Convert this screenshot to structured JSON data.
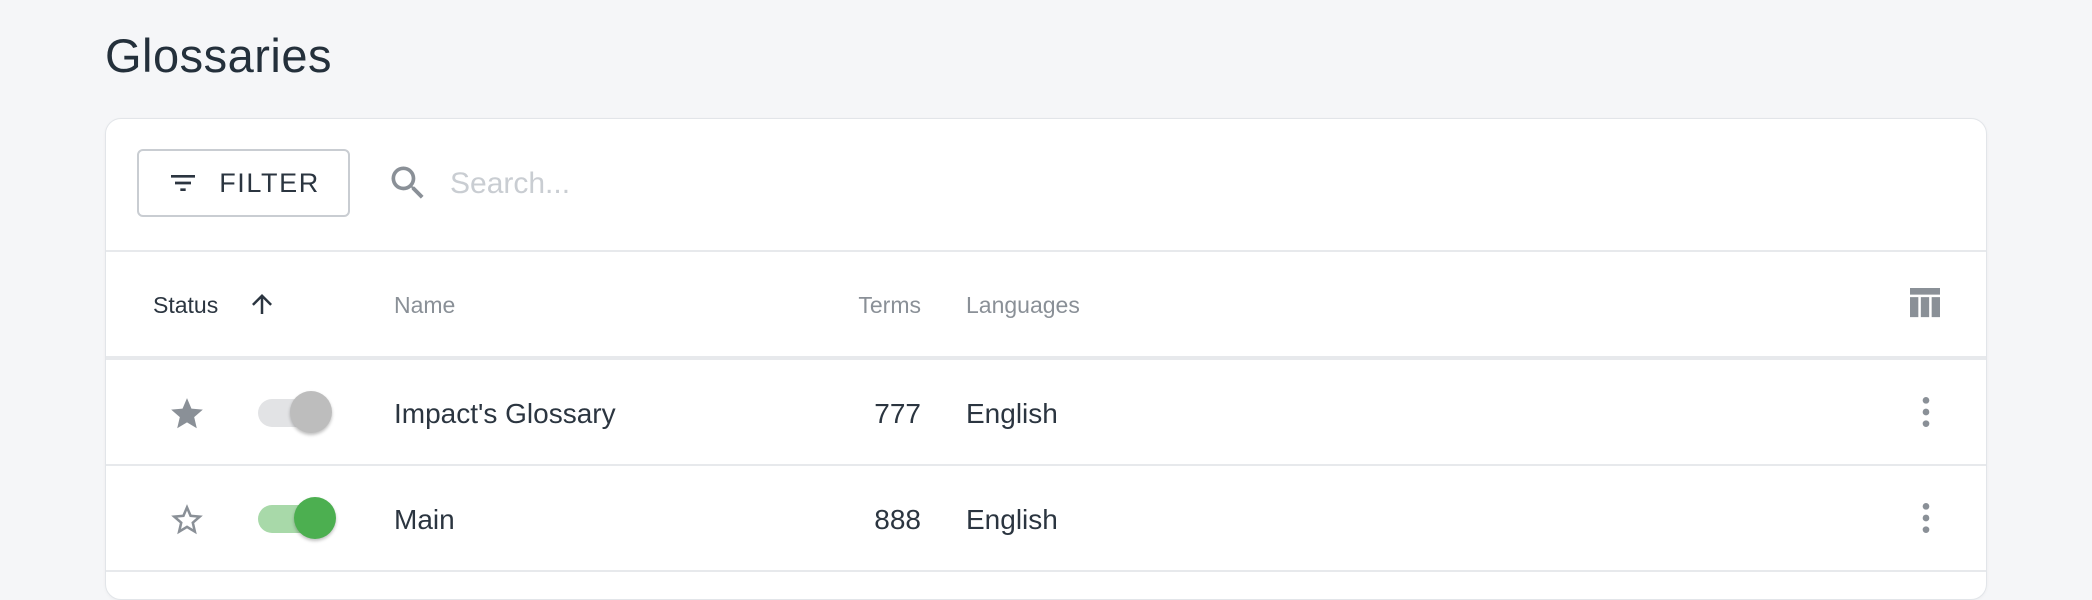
{
  "page": {
    "title": "Glossaries"
  },
  "toolbar": {
    "filter_label": "FILTER",
    "search_placeholder": "Search...",
    "search_value": ""
  },
  "table": {
    "columns": {
      "status": "Status",
      "name": "Name",
      "terms": "Terms",
      "languages": "Languages"
    },
    "sort": {
      "column": "status",
      "direction": "ascending"
    },
    "rows": [
      {
        "favorite": true,
        "enabled": false,
        "name": "Impact's Glossary",
        "terms": "777",
        "languages": "English"
      },
      {
        "favorite": false,
        "enabled": true,
        "name": "Main",
        "terms": "888",
        "languages": "English"
      }
    ]
  },
  "icons": {
    "filter": "filter-list-icon",
    "search": "search-icon",
    "sort": "arrow-up-icon",
    "columns": "view-columns-icon",
    "favorite_on": "star-filled-icon",
    "favorite_off": "star-outline-icon",
    "more": "more-vertical-icon"
  },
  "colors": {
    "background": "#f5f6f8",
    "toggle_on": "#4caf50",
    "toggle_on_track": "#a8d9a9",
    "toggle_off": "#bdbdbd",
    "toggle_off_track": "#e2e3e5",
    "icon_gray": "#8a9097"
  }
}
